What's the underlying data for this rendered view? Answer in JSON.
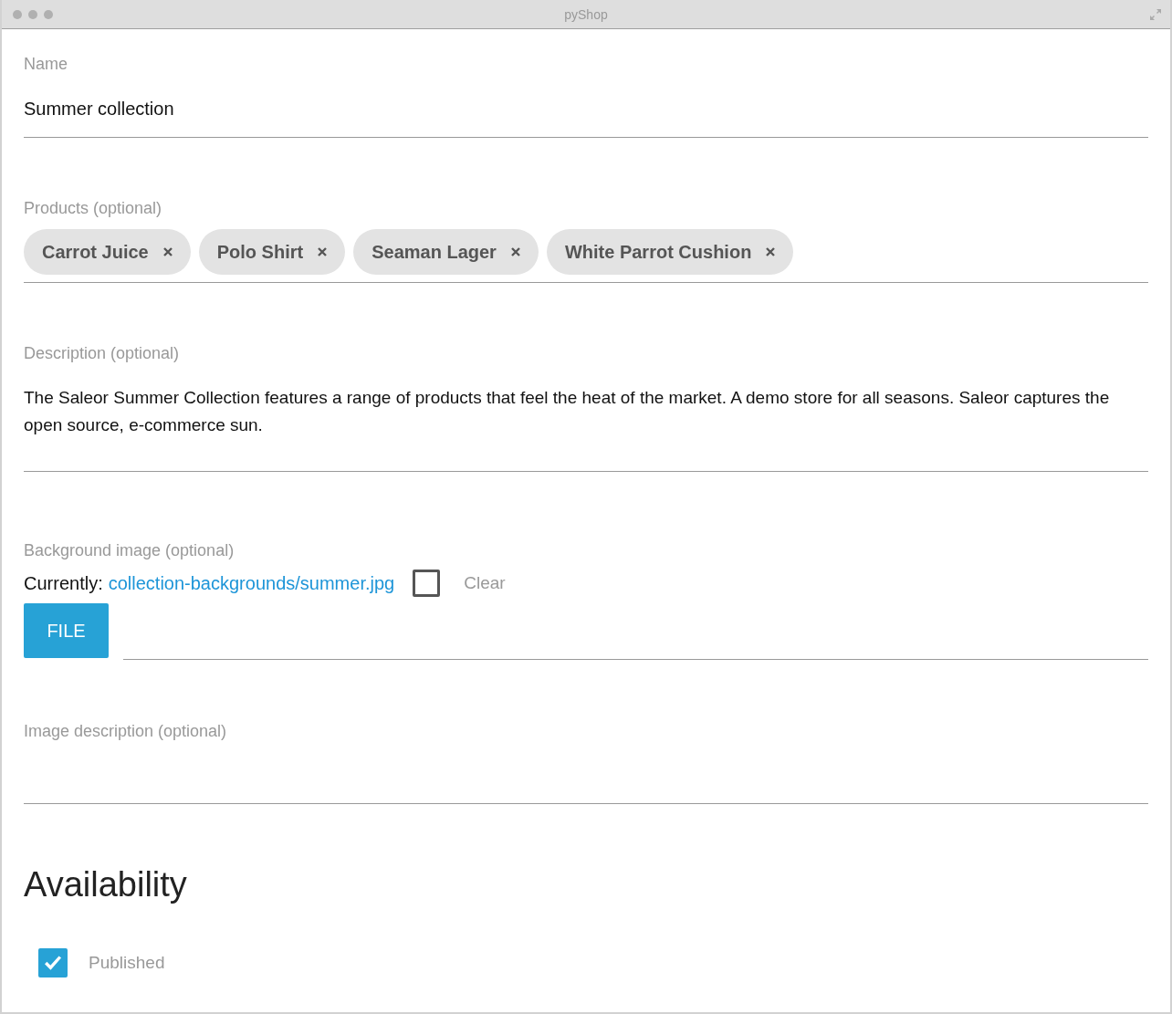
{
  "window": {
    "title": "pyShop"
  },
  "name_field": {
    "label": "Name",
    "value": "Summer collection"
  },
  "products_field": {
    "label": "Products (optional)",
    "chips": [
      {
        "label": "Carrot Juice"
      },
      {
        "label": "Polo Shirt"
      },
      {
        "label": "Seaman Lager"
      },
      {
        "label": "White Parrot Cushion"
      }
    ]
  },
  "description_field": {
    "label": "Description (optional)",
    "value": "The Saleor Summer Collection features a range of products that feel the heat of the market. A demo store for all seasons. Saleor captures the open source, e-commerce sun."
  },
  "background_image": {
    "label": "Background image (optional)",
    "currently_label": "Currently:",
    "file_link": "collection-backgrounds/summer.jpg",
    "clear": {
      "label": "Clear",
      "checked": false
    },
    "file_button": "FILE"
  },
  "image_description_field": {
    "label": "Image description (optional)"
  },
  "availability": {
    "heading": "Availability",
    "published": {
      "label": "Published",
      "checked": true
    }
  }
}
